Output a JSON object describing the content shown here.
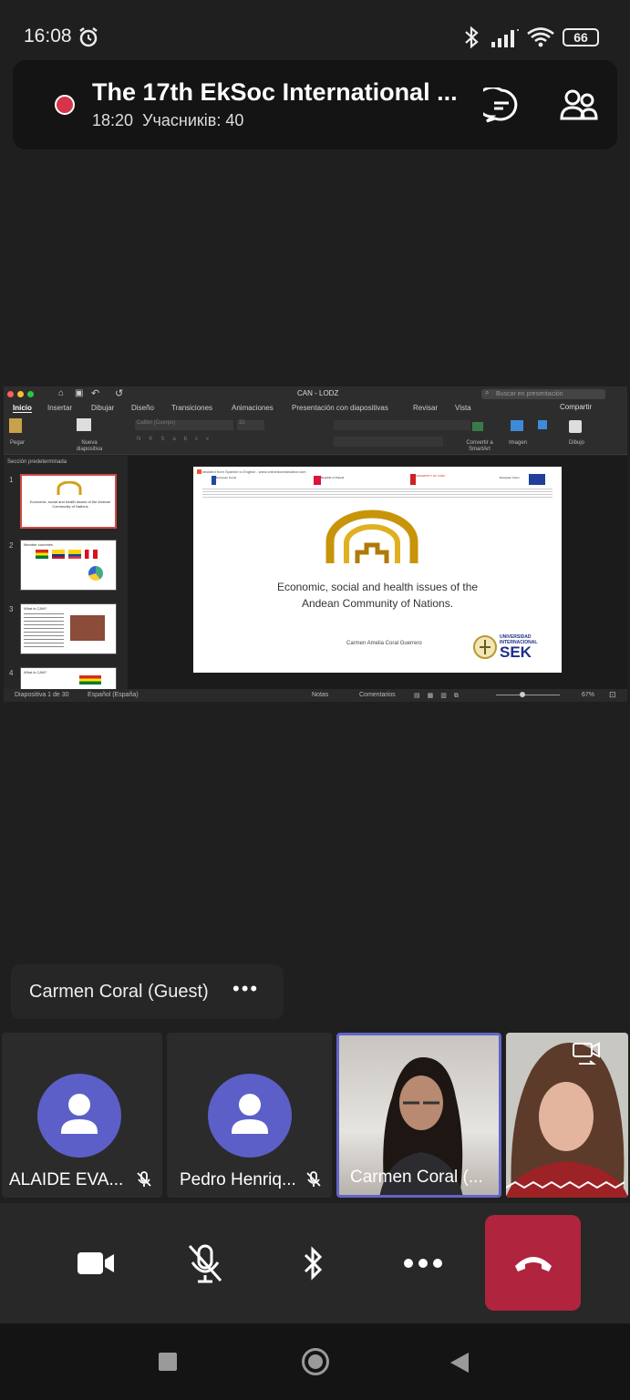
{
  "status": {
    "time": "16:08",
    "battery": "66"
  },
  "meeting": {
    "title": "The 17th EkSoc International ...",
    "duration": "18:20",
    "participants_label": "Учасників: 40"
  },
  "ppt": {
    "doc_title": "CAN  -  LODZ",
    "search_placeholder": "Buscar en presentación",
    "tabs": [
      "Inicio",
      "Insertar",
      "Dibujar",
      "Diseño",
      "Transiciones",
      "Animaciones",
      "Presentación con diapositivas",
      "Revisar",
      "Vista"
    ],
    "share_label": "Compartir",
    "ribbon": {
      "paste": "Pegar",
      "new_slide": "Nueva diapositiva",
      "font": "Calibri (Cuerpo)",
      "size": "32",
      "smartart": "Convertir a SmartArt",
      "image": "Imagen",
      "draw": "Dibujo"
    },
    "section_label": "Sección predeterminada",
    "thumbs": [
      {
        "num": "1",
        "text": "Economic, social and health issues of the Andean Community of Nations"
      },
      {
        "num": "2",
        "text": "Member countries"
      },
      {
        "num": "3",
        "text": "What is CAN?"
      },
      {
        "num": "4",
        "text": "What is CAN?"
      }
    ],
    "slide": {
      "translated": "Translated from Spanish to English - www.onlinedoctranslator.com",
      "logos": [
        "European Funds",
        "Republic of Poland",
        "UNIVERSITY OF LODZ",
        "European Union"
      ],
      "title_line1": "Economic, social and health issues of the",
      "title_line2": "Andean Community of Nations.",
      "author": "Carmen Amelia Coral Guerrero",
      "univ_top": "UNIVERSIDAD",
      "univ_mid": "INTERNACIONAL",
      "univ_sek": "SEK"
    },
    "footer": {
      "slide_count": "Diapositiva 1 de 30",
      "lang": "Español (España)",
      "notes": "Notas",
      "comments": "Comentarios",
      "zoom": "67%"
    }
  },
  "speaker_chip": {
    "name": "Carmen Coral (Guest)"
  },
  "participants": [
    {
      "name": "ALAIDE EVA..."
    },
    {
      "name": "Pedro Henriq..."
    },
    {
      "name": "Carmen Coral (..."
    }
  ]
}
